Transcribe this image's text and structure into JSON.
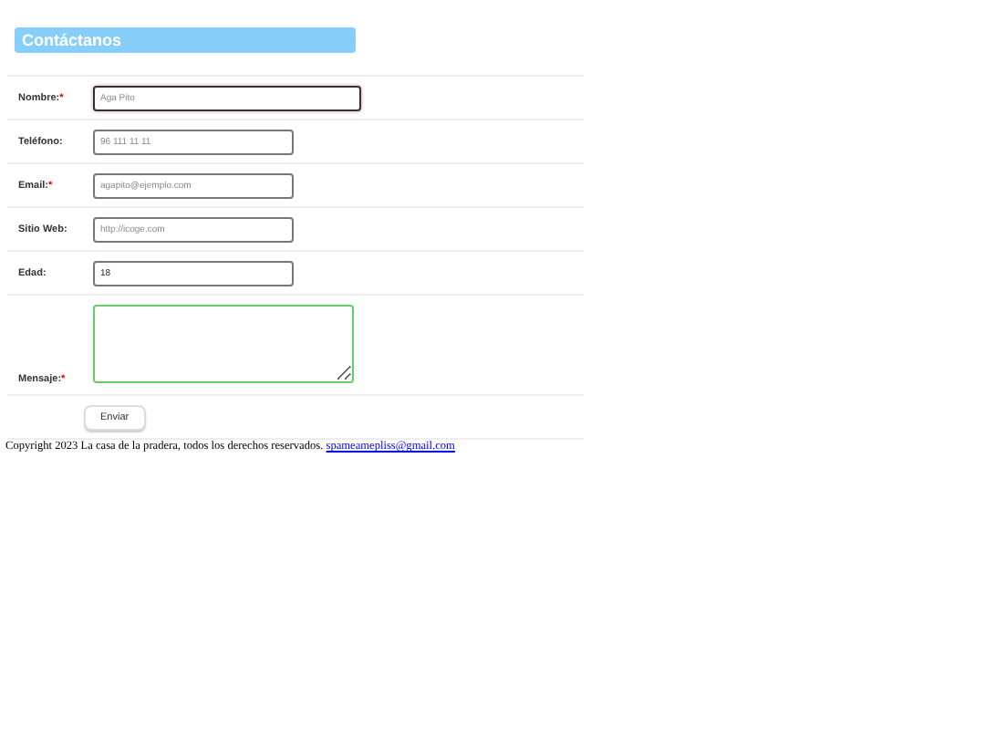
{
  "title": "Contáctanos",
  "fields": [
    {
      "kind": "input",
      "label": "Nombre:",
      "mark": "*",
      "placeholder": "Aga Pito",
      "focused": true
    },
    {
      "kind": "input",
      "label": "Teléfono:",
      "placeholder": "96 111 11 11",
      "focused": false
    },
    {
      "kind": "input",
      "label": "Email:",
      "mark": "*",
      "placeholder": "agapito@ejemplo.com",
      "focused": false
    },
    {
      "kind": "input",
      "label": "Sitio Web:",
      "placeholder": "http://icoge.com",
      "focused": false
    },
    {
      "kind": "input",
      "label": "Edad:",
      "value": "18",
      "focused": false
    },
    {
      "kind": "textarea",
      "label": "Mensaje:",
      "mark": "*",
      "focused": false
    }
  ],
  "submit": "Enviar",
  "footer": {
    "text": "Copyright 2023 La casa de la pradera, todos los derechos reservados.",
    "link": "spameamepliss@gmail.com"
  }
}
